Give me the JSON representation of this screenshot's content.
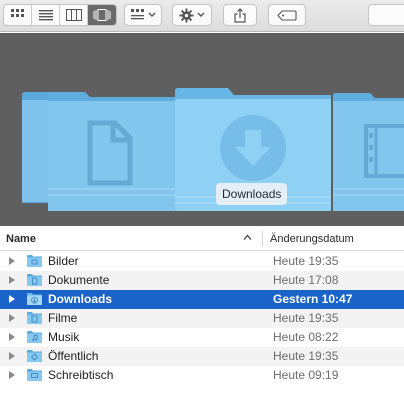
{
  "toolbar": {
    "view_buttons": [
      {
        "name": "icon-view-button",
        "icon": "grid-icon",
        "active": false
      },
      {
        "name": "list-view-button",
        "icon": "list-icon",
        "active": false
      },
      {
        "name": "column-view-button",
        "icon": "columns-icon",
        "active": false
      },
      {
        "name": "coverflow-view-button",
        "icon": "coverflow-icon",
        "active": true
      }
    ],
    "arrange_icon": "arrange-icon",
    "action_icon": "gear-icon",
    "share_icon": "share-icon",
    "tag_icon": "tag-icon"
  },
  "coverflow": {
    "caption": "Downloads",
    "center_icon": "download-arrow-icon",
    "left_icon": "document-icon",
    "right_icon": "film-icon"
  },
  "list": {
    "columns": {
      "name": "Name",
      "date": "Änderungsdatum"
    },
    "rows": [
      {
        "name": "Bilder",
        "date": "Heute 19:35",
        "icon": "pictures-folder-icon",
        "selected": false
      },
      {
        "name": "Dokumente",
        "date": "Heute 17:08",
        "icon": "documents-folder-icon",
        "selected": false
      },
      {
        "name": "Downloads",
        "date": "Gestern 10:47",
        "icon": "downloads-folder-icon",
        "selected": true
      },
      {
        "name": "Filme",
        "date": "Heute 19:35",
        "icon": "movies-folder-icon",
        "selected": false
      },
      {
        "name": "Musik",
        "date": "Heute 08:22",
        "icon": "music-folder-icon",
        "selected": false
      },
      {
        "name": "Öffentlich",
        "date": "Heute 19:35",
        "icon": "public-folder-icon",
        "selected": false
      },
      {
        "name": "Schreibtisch",
        "date": "Heute 09:19",
        "icon": "desktop-folder-icon",
        "selected": false
      }
    ]
  },
  "colors": {
    "selection": "#1a63c8",
    "folder": "#7cc3ee",
    "coverflow_background": "#5f5f5f"
  }
}
